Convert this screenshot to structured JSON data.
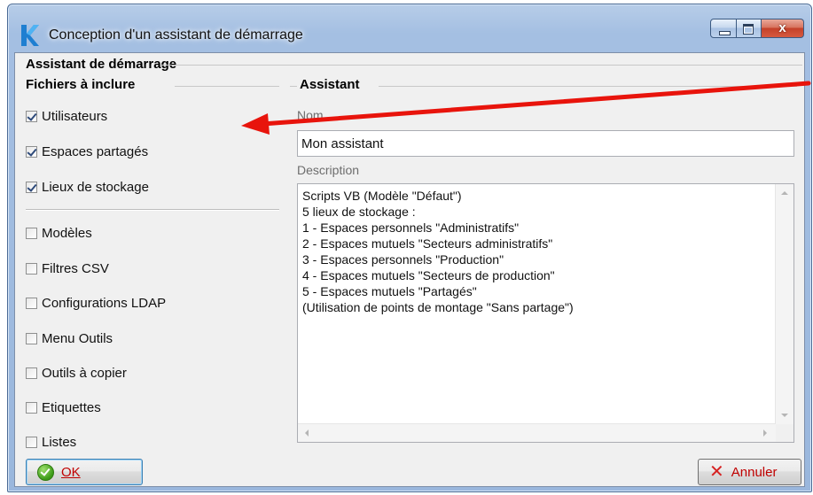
{
  "window": {
    "title": "Conception d'un assistant de démarrage",
    "close_glyph": "x"
  },
  "outer_group": {
    "title": "Assistant de démarrage"
  },
  "files": {
    "title": "Fichiers à inclure",
    "items": [
      {
        "label": "Utilisateurs",
        "checked": true
      },
      {
        "label": "Espaces partagés",
        "checked": true
      },
      {
        "label": "Lieux de stockage",
        "checked": true
      },
      {
        "label": "Modèles",
        "checked": false
      },
      {
        "label": "Filtres CSV",
        "checked": false
      },
      {
        "label": "Configurations LDAP",
        "checked": false
      },
      {
        "label": "Menu Outils",
        "checked": false
      },
      {
        "label": "Outils à copier",
        "checked": false
      },
      {
        "label": "Etiquettes",
        "checked": false
      },
      {
        "label": "Listes",
        "checked": false
      }
    ]
  },
  "assistant": {
    "title": "Assistant",
    "name_label": "Nom",
    "name_value": "Mon assistant",
    "description_label": "Description",
    "description_lines": [
      "Scripts VB (Modèle \"Défaut\")",
      "5 lieux de stockage :",
      "1 - Espaces personnels \"Administratifs\"",
      "2 - Espaces mutuels \"Secteurs administratifs\"",
      "3 - Espaces personnels \"Production\"",
      "4 - Espaces mutuels \"Secteurs de production\"",
      "5 - Espaces mutuels \"Partagés\"",
      "(Utilisation de points de montage \"Sans partage\")"
    ]
  },
  "buttons": {
    "ok": "OK",
    "cancel": "Annuler"
  },
  "colors": {
    "annotation_arrow": "#e8140c",
    "accent_label": "#c00000"
  },
  "icons": {
    "app": "k-logo-icon",
    "ok": "check-circle-icon",
    "cancel": "red-x-icon"
  }
}
